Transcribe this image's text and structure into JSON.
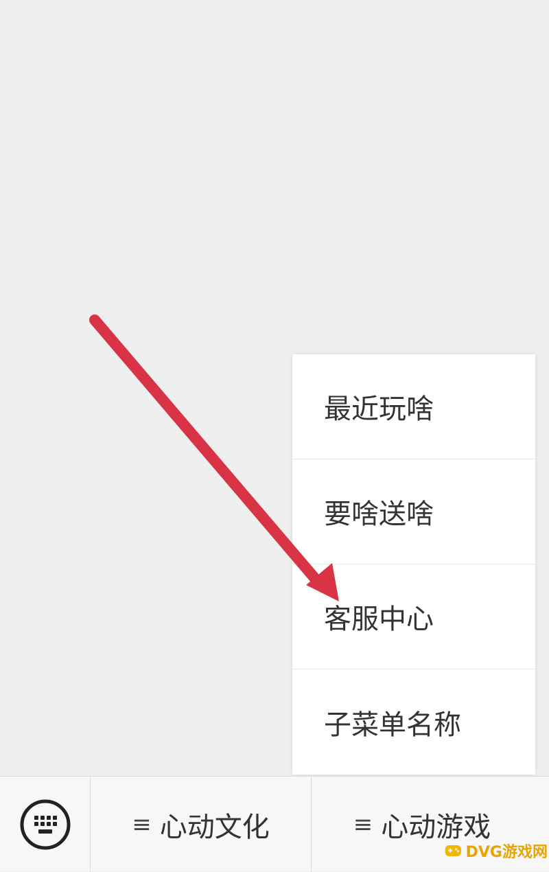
{
  "popup_menu": {
    "items": [
      {
        "label": "最近玩啥"
      },
      {
        "label": "要啥送啥"
      },
      {
        "label": "客服中心"
      },
      {
        "label": "子菜单名称"
      }
    ]
  },
  "menu_bar": {
    "keyboard_icon": "keyboard-icon",
    "tabs": [
      {
        "label": "心动文化",
        "icon": "menu-lines-icon"
      },
      {
        "label": "心动游戏",
        "icon": "menu-lines-icon"
      }
    ]
  },
  "annotation": {
    "arrow_color": "#d93446"
  },
  "watermark": {
    "text": "DVG游戏网",
    "color": "#e8a400"
  }
}
